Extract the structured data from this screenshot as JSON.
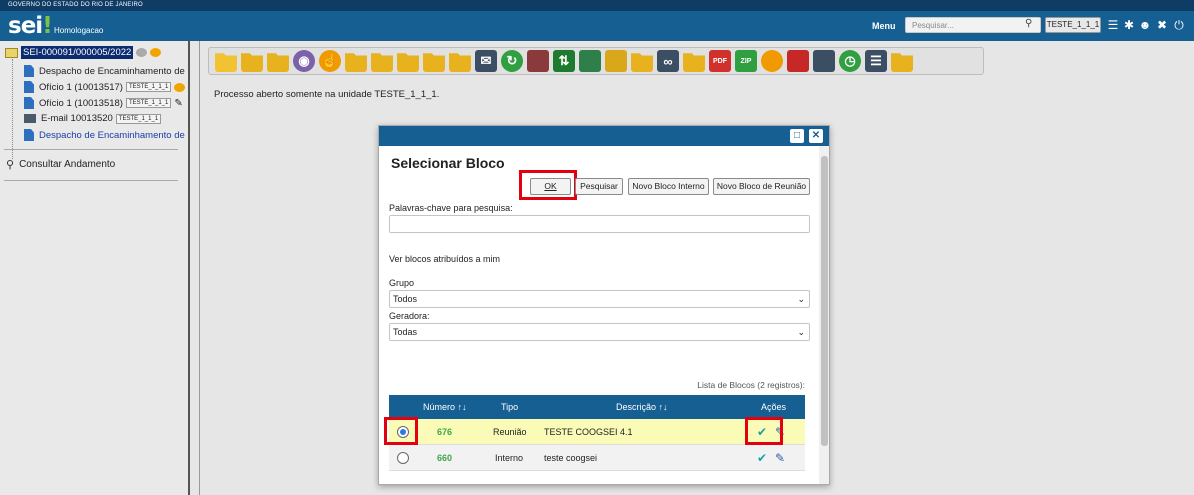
{
  "gov_strip": "GOVERNO DO ESTADO DO RIO DE JANEIRO",
  "header": {
    "logo": "sei",
    "logo_dot": "!",
    "environment": "Homologacao",
    "menu_label": "Menu",
    "search_placeholder": "Pesquisar...",
    "unit": "TESTE_1_1_1"
  },
  "tree": {
    "process_number": "SEI-000091/000005/2022",
    "items": [
      {
        "label": "Despacho de Encaminhamento de Pr",
        "tag": ""
      },
      {
        "label": "Ofício 1 (10013517)",
        "tag": "TESTE_1_1_1"
      },
      {
        "label": "Ofício 1 (10013518)",
        "tag": "TESTE_1_1_1"
      },
      {
        "label": "E-mail 10013520",
        "tag": "TESTE_1_1_1"
      },
      {
        "label": "Despacho de Encaminhamento de Pr",
        "tag": ""
      }
    ],
    "consult_label": "Consultar Andamento"
  },
  "toolbar_icons": [
    "new-document-icon",
    "sign-folder-icon",
    "users-icon",
    "eye-icon",
    "thumb-icon",
    "forward-folder-icon",
    "info-folder-icon",
    "user-folder-icon",
    "star-folder-icon",
    "folder-icon",
    "mail-icon",
    "sync-icon",
    "briefcase-icon",
    "transfer-icon",
    "building-icon",
    "clipboard-icon",
    "pause-folder-icon",
    "link-icon",
    "cancel-folder-icon",
    "pdf-icon",
    "zip-icon",
    "comment-icon",
    "flag-icon",
    "tag-icon",
    "clock-icon",
    "list-icon",
    "search-folder-icon"
  ],
  "toolbar_text": {
    "pdf": "PDF",
    "zip": "ZIP"
  },
  "status_message": "Processo aberto somente na unidade TESTE_1_1_1.",
  "modal": {
    "title": "Selecionar Bloco",
    "buttons": {
      "ok": "OK",
      "pesquisar": "Pesquisar",
      "novo_interno": "Novo Bloco Interno",
      "novo_reuniao": "Novo Bloco de Reunião"
    },
    "keywords_label": "Palavras-chave para pesquisa:",
    "keywords_value": "",
    "assigned_label": "Ver blocos atribuídos a mim",
    "grupo_label": "Grupo",
    "grupo_value": "Todos",
    "geradora_label": "Geradora:",
    "geradora_value": "Todas",
    "list_caption": "Lista de Blocos (2 registros):",
    "columns": [
      "Número",
      "Tipo",
      "Descrição",
      "Ações"
    ],
    "rows": [
      {
        "numero": "676",
        "tipo": "Reunião",
        "descricao": "TESTE COOGSEI 4.1",
        "selected": true
      },
      {
        "numero": "660",
        "tipo": "Interno",
        "descricao": "teste coogsei",
        "selected": false
      }
    ]
  },
  "colors": {
    "header": "#155f92",
    "gov_strip": "#0f3c64",
    "highlight": "#e3000f",
    "selected_row": "#fbfbb8",
    "number_green": "#3fa64a"
  }
}
